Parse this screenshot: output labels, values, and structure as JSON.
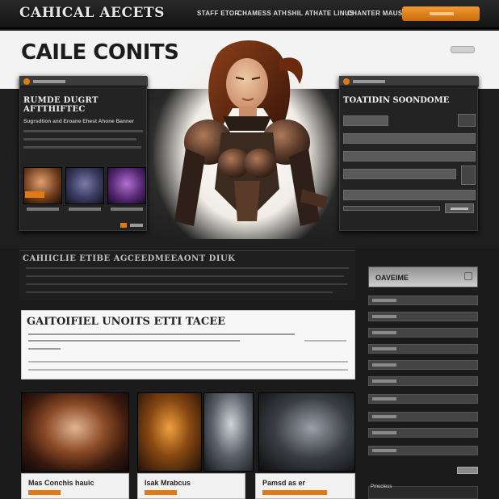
{
  "header": {
    "logo": "CAHICAL AECETS",
    "nav": [
      "STAFF ETOR",
      "CHAMESS ATH",
      "SHIL ATHATE LINUS",
      "CHANTER MAUS"
    ],
    "cta_label": ""
  },
  "hero": {
    "title": "CAILE CONITS",
    "left_panel": {
      "title": "RUMDE DUGRT AFTTHIFTEC",
      "subtitle": "Sugrsdtion and Eroane Ehest Ahone Banner"
    },
    "right_panel": {
      "title": "TOATIDIN SOONDOME"
    }
  },
  "mid_section": {
    "title": "CAHIICLIE ETIBE AGCEEDMEEAONT DIUK"
  },
  "article": {
    "title": "GAITOIFIEL UNOITS ETTI TACEE"
  },
  "gallery": [
    {
      "title": "Mas Conchis hauic"
    },
    {
      "title": "Isak Mrabcus"
    },
    {
      "title": ""
    },
    {
      "title": "Pamsd as er"
    }
  ],
  "sidebar": {
    "title": "OAVEIME",
    "footer": "Pmoctess"
  },
  "colors": {
    "accent": "#e07a12",
    "background": "#1b1b1b"
  }
}
